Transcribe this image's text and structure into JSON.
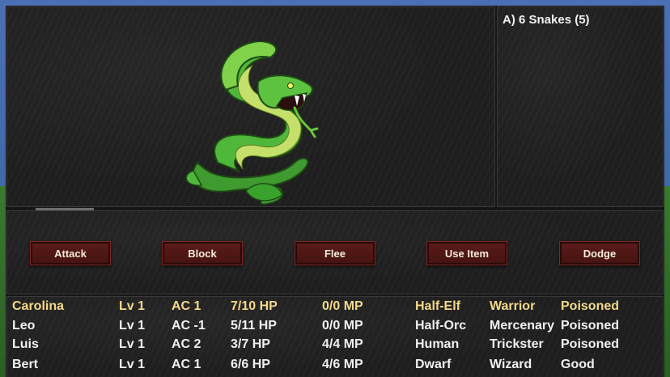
{
  "enemy_panel": {
    "groups": [
      "A) 6 Snakes (5)"
    ]
  },
  "monster": {
    "name_icon": "snake-icon"
  },
  "actions": [
    "Attack",
    "Block",
    "Flee",
    "Use Item",
    "Dodge"
  ],
  "party": [
    {
      "name": "Carolina",
      "level": "Lv 1",
      "ac": "AC 1",
      "hp": "7/10 HP",
      "mp": "0/0 MP",
      "race": "Half-Elf",
      "class": "Warrior",
      "status": "Poisoned",
      "active": true
    },
    {
      "name": "Leo",
      "level": "Lv 1",
      "ac": "AC -1",
      "hp": "5/11 HP",
      "mp": "0/0 MP",
      "race": "Half-Orc",
      "class": "Mercenary",
      "status": "Poisoned",
      "active": false
    },
    {
      "name": "Luis",
      "level": "Lv 1",
      "ac": "AC 2",
      "hp": "3/7 HP",
      "mp": "4/4 MP",
      "race": "Human",
      "class": "Trickster",
      "status": "Poisoned",
      "active": false
    },
    {
      "name": "Bert",
      "level": "Lv 1",
      "ac": "AC 1",
      "hp": "6/6 HP",
      "mp": "4/6 MP",
      "race": "Dwarf",
      "class": "Wizard",
      "status": "Good",
      "active": false
    }
  ],
  "colors": {
    "active_member": "#f4d98a",
    "text": "#f0f0f0",
    "button_bg": "#521816"
  }
}
